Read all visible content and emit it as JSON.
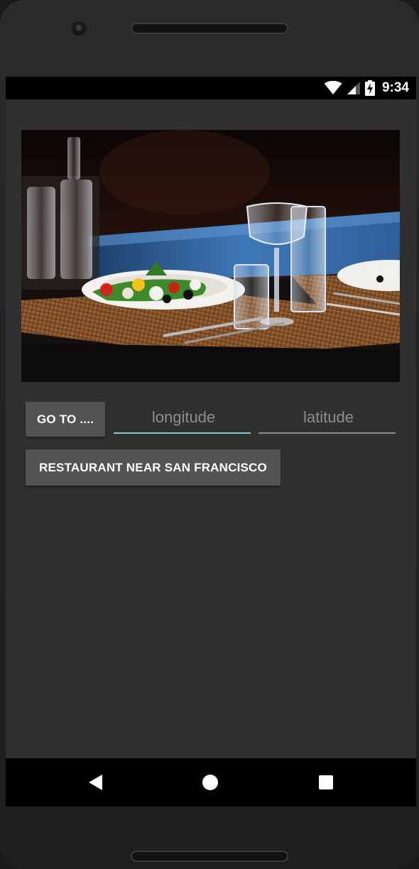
{
  "status_bar": {
    "time": "9:34",
    "icons": [
      "wifi-icon",
      "signal-icon",
      "battery-charging-icon"
    ]
  },
  "hero": {
    "icon": "restaurant-table-photo"
  },
  "controls": {
    "goto_label": "GO TO ....",
    "longitude_placeholder": "longitude",
    "latitude_placeholder": "latitude",
    "longitude_value": "",
    "latitude_value": "",
    "restaurant_label": "RESTAURANT NEAR SAN FRANCISCO",
    "accent_color": "#80cbc4"
  },
  "nav_bar": {
    "icons": [
      "back-icon",
      "home-icon",
      "recents-icon"
    ]
  }
}
